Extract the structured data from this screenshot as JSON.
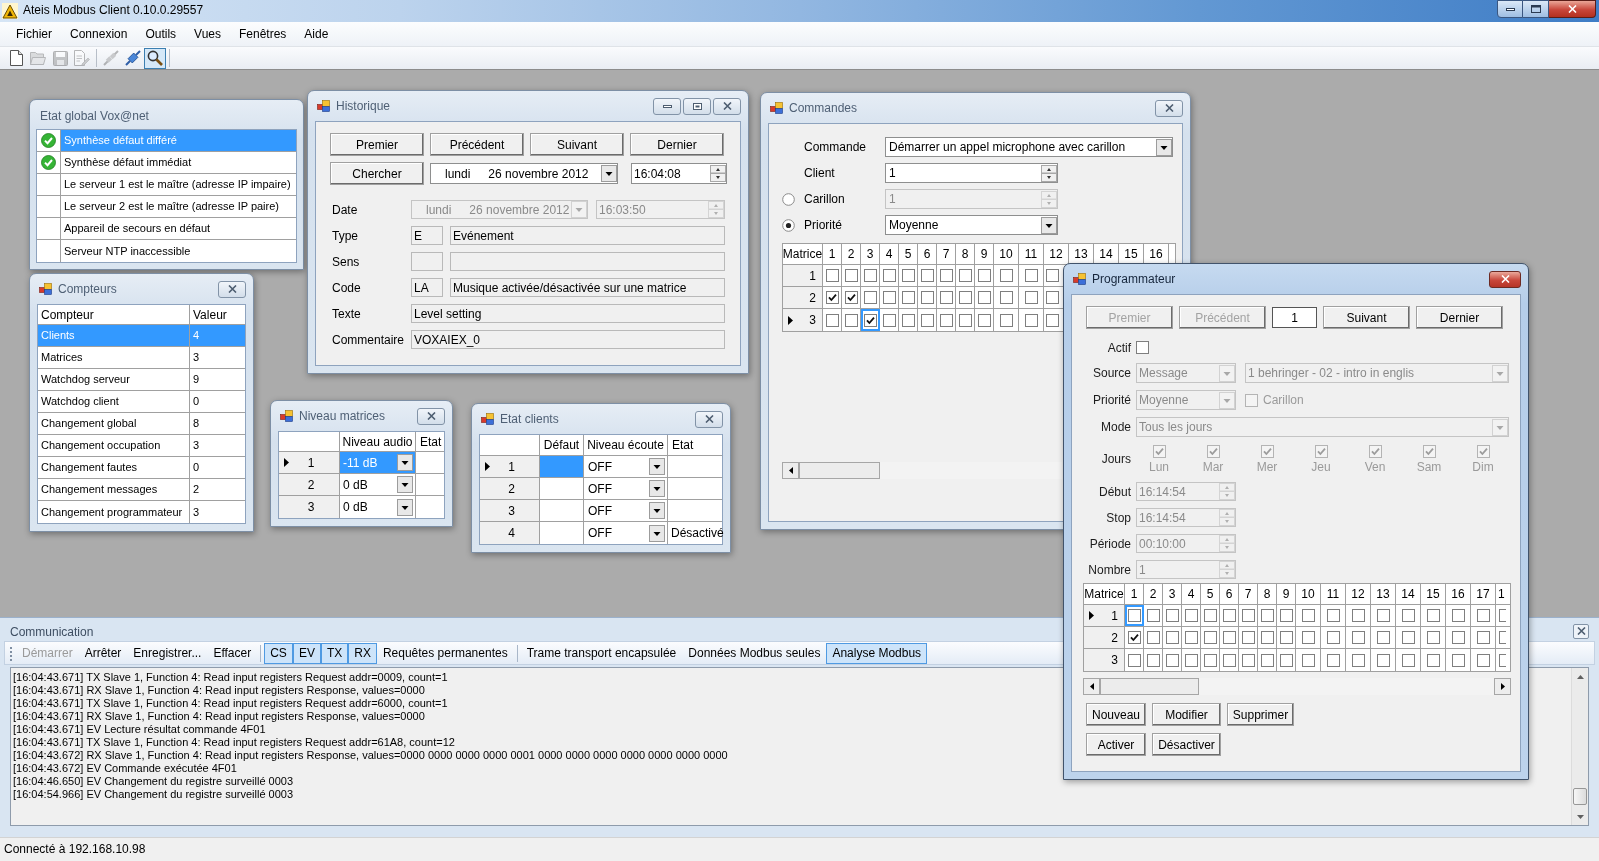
{
  "window": {
    "title": "Ateis Modbus Client 0.10.0.29557"
  },
  "menu": [
    "Fichier",
    "Connexion",
    "Outils",
    "Vues",
    "Fenêtres",
    "Aide"
  ],
  "toolbar": [
    [
      {
        "kind": "new",
        "disabled": false,
        "pressed": false
      },
      {
        "kind": "open",
        "disabled": true,
        "pressed": false
      },
      {
        "kind": "save",
        "disabled": true,
        "pressed": false
      },
      {
        "kind": "edit",
        "disabled": true,
        "pressed": false
      }
    ],
    [
      {
        "kind": "disconnect",
        "disabled": true,
        "pressed": false
      },
      {
        "kind": "connect",
        "disabled": false,
        "pressed": false
      },
      {
        "kind": "search",
        "disabled": false,
        "pressed": true
      }
    ]
  ],
  "etat_global": {
    "title": "Etat global Vox@net",
    "items": [
      {
        "label": "Synthèse défaut différé",
        "ok": true,
        "selected": true
      },
      {
        "label": "Synthèse défaut immédiat",
        "ok": true,
        "selected": false
      },
      {
        "label": "Le serveur 1 est le maître (adresse IP impaire)",
        "ok": false,
        "selected": false
      },
      {
        "label": "Le serveur 2 est le maître (adresse IP paire)",
        "ok": false,
        "selected": false
      },
      {
        "label": "Appareil de secours en défaut",
        "ok": false,
        "selected": false
      },
      {
        "label": "Serveur NTP inaccessible",
        "ok": false,
        "selected": false
      }
    ]
  },
  "compteurs": {
    "title": "Compteurs",
    "columns": [
      "Compteur",
      "Valeur"
    ],
    "rows": [
      {
        "name": "Clients",
        "value": "4",
        "selected": true
      },
      {
        "name": "Matrices",
        "value": "3",
        "selected": false
      },
      {
        "name": "Watchdog serveur",
        "value": "9",
        "selected": false
      },
      {
        "name": "Watchdog client",
        "value": "0",
        "selected": false
      },
      {
        "name": "Changement global",
        "value": "8",
        "selected": false
      },
      {
        "name": "Changement occupation",
        "value": "3",
        "selected": false
      },
      {
        "name": "Changement fautes",
        "value": "0",
        "selected": false
      },
      {
        "name": "Changement messages",
        "value": "2",
        "selected": false
      },
      {
        "name": "Changement programmateur",
        "value": "3",
        "selected": false
      }
    ]
  },
  "historique": {
    "title": "Historique",
    "nav": [
      "Premier",
      "Précédent",
      "Suivant",
      "Dernier"
    ],
    "search": {
      "button": "Chercher",
      "day": "lundi",
      "date": "26 novembre 2012",
      "time": "16:04:08"
    },
    "fields": [
      {
        "label": "Date",
        "kind": "datetime",
        "day": "lundi",
        "date": "26 novembre 2012",
        "time": "16:03:50"
      },
      {
        "label": "Type",
        "kind": "pair",
        "code": "E",
        "value": "Evénement"
      },
      {
        "label": "Sens",
        "kind": "pair"
      },
      {
        "label": "Code",
        "kind": "pair",
        "code": "LA",
        "value": "Musique activée/désactivée sur une matrice"
      },
      {
        "label": "Texte",
        "kind": "single",
        "value": "Level setting"
      },
      {
        "label": "Commentaire",
        "kind": "single",
        "value": "VOXAIEX_0"
      }
    ]
  },
  "niveau_matrices": {
    "title": "Niveau matrices",
    "columns": [
      "Niveau audio",
      "Etat"
    ],
    "rows": [
      {
        "index": "1",
        "audio": "-11 dB",
        "current": true,
        "selected": true
      },
      {
        "index": "2",
        "audio": "0 dB",
        "current": false,
        "selected": false
      },
      {
        "index": "3",
        "audio": "0 dB",
        "current": false,
        "selected": false
      }
    ]
  },
  "etat_clients": {
    "title": "Etat clients",
    "columns": [
      "Défaut",
      "Niveau écoute",
      "Etat"
    ],
    "rows": [
      {
        "index": "1",
        "listen": "OFF",
        "current": true,
        "selected": true
      },
      {
        "index": "2",
        "listen": "OFF",
        "current": false,
        "selected": false
      },
      {
        "index": "3",
        "listen": "OFF",
        "current": false,
        "selected": false
      },
      {
        "index": "4",
        "listen": "OFF",
        "state": "Désactivé",
        "current": false,
        "selected": false
      }
    ]
  },
  "commandes": {
    "title": "Commandes",
    "fields": [
      {
        "label": "Commande",
        "kind": "combo",
        "value": "Démarrer un appel microphone avec carillon",
        "disabled": false
      },
      {
        "label": "Client",
        "kind": "spin",
        "value": "1",
        "disabled": false
      },
      {
        "label": "Carillon",
        "kind": "spin",
        "value": "1",
        "disabled": true,
        "radio": {
          "selected": false
        }
      },
      {
        "label": "Priorité",
        "kind": "combo",
        "value": "Moyenne",
        "disabled": false,
        "radio": {
          "selected": true
        }
      }
    ],
    "grid": {
      "header": "Matrice",
      "columns": [
        "1",
        "2",
        "3",
        "4",
        "5",
        "6",
        "7",
        "8",
        "9",
        "10",
        "11",
        "12",
        "13",
        "14",
        "15",
        "16"
      ],
      "rows": [
        {
          "label": "1",
          "current": false,
          "cells": [
            {
              "checked": false,
              "selected": false
            },
            {
              "checked": false,
              "selected": false
            },
            {
              "checked": false,
              "selected": false
            },
            {
              "checked": false,
              "selected": false
            },
            {
              "checked": false,
              "selected": false
            },
            {
              "checked": false,
              "selected": false
            },
            {
              "checked": false,
              "selected": false
            },
            {
              "checked": false,
              "selected": false
            },
            {
              "checked": false,
              "selected": false
            },
            {
              "checked": false,
              "selected": false
            },
            {
              "checked": false,
              "selected": false
            },
            {
              "checked": false,
              "selected": false
            }
          ]
        },
        {
          "label": "2",
          "current": false,
          "cells": [
            {
              "checked": true,
              "selected": false
            },
            {
              "checked": true,
              "selected": false
            },
            {
              "checked": false,
              "selected": false
            },
            {
              "checked": false,
              "selected": false
            },
            {
              "checked": false,
              "selected": false
            },
            {
              "checked": false,
              "selected": false
            },
            {
              "checked": false,
              "selected": false
            },
            {
              "checked": false,
              "selected": false
            },
            {
              "checked": false,
              "selected": false
            },
            {
              "checked": false,
              "selected": false
            },
            {
              "checked": false,
              "selected": false
            },
            {
              "checked": false,
              "selected": false
            }
          ]
        },
        {
          "label": "3",
          "current": true,
          "cells": [
            {
              "checked": false,
              "selected": false
            },
            {
              "checked": false,
              "selected": false
            },
            {
              "checked": true,
              "selected": true
            },
            {
              "checked": false,
              "selected": false
            },
            {
              "checked": false,
              "selected": false
            },
            {
              "checked": false,
              "selected": false
            },
            {
              "checked": false,
              "selected": false
            },
            {
              "checked": false,
              "selected": false
            },
            {
              "checked": false,
              "selected": false
            },
            {
              "checked": false,
              "selected": false
            },
            {
              "checked": false,
              "selected": false
            },
            {
              "checked": false,
              "selected": false
            }
          ]
        }
      ]
    }
  },
  "programmateur": {
    "title": "Programmateur",
    "nav": [
      {
        "kind": "button",
        "label": "Premier",
        "disabled": true
      },
      {
        "kind": "button",
        "label": "Précédent",
        "disabled": true
      },
      {
        "kind": "field",
        "value": "1"
      },
      {
        "kind": "button",
        "label": "Suivant",
        "disabled": false
      },
      {
        "kind": "button",
        "label": "Dernier",
        "disabled": false
      }
    ],
    "actif": {
      "label": "Actif",
      "checked": false
    },
    "source": {
      "label": "Source",
      "value": "Message",
      "detail": "1 behringer - 02 - intro in englis",
      "disabled": true
    },
    "priorite": {
      "label": "Priorité",
      "value": "Moyenne",
      "disabled": true,
      "carillon": {
        "label": "Carillon",
        "checked": false
      }
    },
    "mode": {
      "label": "Mode",
      "value": "Tous les jours",
      "disabled": true
    },
    "jours": {
      "label": "Jours",
      "disabled": true,
      "days": [
        {
          "label": "Lun",
          "checked": true
        },
        {
          "label": "Mar",
          "checked": true
        },
        {
          "label": "Mer",
          "checked": true
        },
        {
          "label": "Jeu",
          "checked": true
        },
        {
          "label": "Ven",
          "checked": true
        },
        {
          "label": "Sam",
          "checked": true
        },
        {
          "label": "Dim",
          "checked": true
        }
      ]
    },
    "spins": [
      {
        "label": "Début",
        "value": "16:14:54",
        "disabled": true
      },
      {
        "label": "Stop",
        "value": "16:14:54",
        "disabled": true
      },
      {
        "label": "Période",
        "value": "00:10:00",
        "disabled": true
      },
      {
        "label": "Nombre",
        "value": "1",
        "disabled": true
      }
    ],
    "grid": {
      "header": "Matrice",
      "columns": [
        "1",
        "2",
        "3",
        "4",
        "5",
        "6",
        "7",
        "8",
        "9",
        "10",
        "11",
        "12",
        "13",
        "14",
        "15",
        "16",
        "17",
        "1"
      ],
      "rows": [
        {
          "label": "1",
          "current": true,
          "cells": [
            {
              "checked": false,
              "selected": true
            },
            {
              "checked": false,
              "selected": false
            },
            {
              "checked": false,
              "selected": false
            },
            {
              "checked": false,
              "selected": false
            },
            {
              "checked": false,
              "selected": false
            },
            {
              "checked": false,
              "selected": false
            },
            {
              "checked": false,
              "selected": false
            },
            {
              "checked": false,
              "selected": false
            },
            {
              "checked": false,
              "selected": false
            },
            {
              "checked": false,
              "selected": false
            },
            {
              "checked": false,
              "selected": false
            },
            {
              "checked": false,
              "selected": false
            },
            {
              "checked": false,
              "selected": false
            },
            {
              "checked": false,
              "selected": false
            },
            {
              "checked": false,
              "selected": false
            },
            {
              "checked": false,
              "selected": false
            },
            {
              "checked": false,
              "selected": false
            },
            {
              "checked": false,
              "selected": false
            }
          ]
        },
        {
          "label": "2",
          "current": false,
          "cells": [
            {
              "checked": true,
              "selected": false
            },
            {
              "checked": false,
              "selected": false
            },
            {
              "checked": false,
              "selected": false
            },
            {
              "checked": false,
              "selected": false
            },
            {
              "checked": false,
              "selected": false
            },
            {
              "checked": false,
              "selected": false
            },
            {
              "checked": false,
              "selected": false
            },
            {
              "checked": false,
              "selected": false
            },
            {
              "checked": false,
              "selected": false
            },
            {
              "checked": false,
              "selected": false
            },
            {
              "checked": false,
              "selected": false
            },
            {
              "checked": false,
              "selected": false
            },
            {
              "checked": false,
              "selected": false
            },
            {
              "checked": false,
              "selected": false
            },
            {
              "checked": false,
              "selected": false
            },
            {
              "checked": false,
              "selected": false
            },
            {
              "checked": false,
              "selected": false
            },
            {
              "checked": false,
              "selected": false
            }
          ]
        },
        {
          "label": "3",
          "current": false,
          "cells": [
            {
              "checked": false,
              "selected": false
            },
            {
              "checked": false,
              "selected": false
            },
            {
              "checked": false,
              "selected": false
            },
            {
              "checked": false,
              "selected": false
            },
            {
              "checked": false,
              "selected": false
            },
            {
              "checked": false,
              "selected": false
            },
            {
              "checked": false,
              "selected": false
            },
            {
              "checked": false,
              "selected": false
            },
            {
              "checked": false,
              "selected": false
            },
            {
              "checked": false,
              "selected": false
            },
            {
              "checked": false,
              "selected": false
            },
            {
              "checked": false,
              "selected": false
            },
            {
              "checked": false,
              "selected": false
            },
            {
              "checked": false,
              "selected": false
            },
            {
              "checked": false,
              "selected": false
            },
            {
              "checked": false,
              "selected": false
            },
            {
              "checked": false,
              "selected": false
            },
            {
              "checked": false,
              "selected": false
            }
          ]
        }
      ]
    },
    "actions": [
      [
        "Nouveau",
        "Modifier",
        "Supprimer"
      ],
      [
        "Activer",
        "Désactiver"
      ]
    ]
  },
  "communication": {
    "title": "Communication",
    "toolbar": [
      [
        {
          "kind": "button",
          "label": "Démarrer",
          "disabled": true
        },
        {
          "kind": "button",
          "label": "Arrêter",
          "disabled": false
        },
        {
          "kind": "button",
          "label": "Enregistrer...",
          "disabled": false
        },
        {
          "kind": "button",
          "label": "Effacer",
          "disabled": false
        }
      ],
      [
        {
          "kind": "toggle",
          "label": "CS",
          "checked": true
        },
        {
          "kind": "toggle",
          "label": "EV",
          "checked": true
        },
        {
          "kind": "toggle",
          "label": "TX",
          "checked": true
        },
        {
          "kind": "toggle",
          "label": "RX",
          "checked": true
        },
        {
          "kind": "toggle",
          "label": "Requêtes permanentes",
          "checked": false
        }
      ],
      [
        {
          "kind": "toggle",
          "label": "Trame transport encapsulée",
          "checked": false
        },
        {
          "kind": "toggle",
          "label": "Données Modbus seules",
          "checked": false
        },
        {
          "kind": "toggle",
          "label": "Analyse Modbus",
          "checked": true
        }
      ]
    ],
    "log": [
      "[16:04:43.671] TX Slave 1, Function 4: Read input registers Request addr=0009, count=1",
      "[16:04:43.671] RX Slave 1, Function 4: Read input registers Response, values=0000",
      "[16:04:43.671] TX Slave 1, Function 4: Read input registers Request addr=6000, count=1",
      "[16:04:43.671] RX Slave 1, Function 4: Read input registers Response, values=0000",
      "[16:04:43.671] EV Lecture résultat commande 4F01",
      "[16:04:43.671] TX Slave 1, Function 4: Read input registers Request addr=61A8, count=12",
      "[16:04:43.672] RX Slave 1, Function 4: Read input registers Response, values=0000 0000 0000 0000 0001 0000 0000 0000 0000 0000 0000 0000",
      "[16:04:43.672] EV Commande exécutée 4F01",
      "[16:04:46.650] EV Changement du registre surveillé 0003",
      "[16:04:54.966] EV Changement du registre surveillé 0003"
    ]
  },
  "status_bar": {
    "text": "Connecté à 192.168.10.98"
  }
}
